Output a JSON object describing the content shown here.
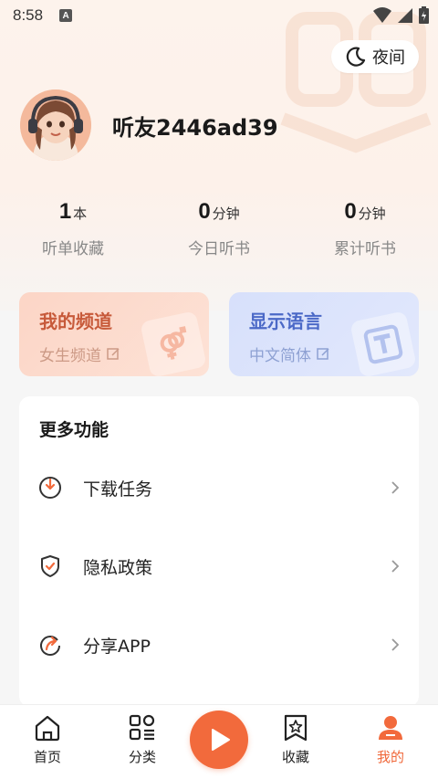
{
  "status_bar": {
    "time": "8:58",
    "notification_badge": "A"
  },
  "header": {
    "night_mode_label": "夜间"
  },
  "profile": {
    "username": "听友2446ad39"
  },
  "stats": [
    {
      "value": "1",
      "unit": "本",
      "label": "听单收藏"
    },
    {
      "value": "0",
      "unit": "分钟",
      "label": "今日听书"
    },
    {
      "value": "0",
      "unit": "分钟",
      "label": "累计听书"
    }
  ],
  "cards": {
    "channel": {
      "title": "我的频道",
      "value": "女生频道"
    },
    "language": {
      "title": "显示语言",
      "value": "中文简体"
    }
  },
  "more": {
    "title": "更多功能",
    "items": [
      {
        "label": "下载任务",
        "icon": "download-icon"
      },
      {
        "label": "隐私政策",
        "icon": "shield-check-icon"
      },
      {
        "label": "分享APP",
        "icon": "share-icon"
      }
    ]
  },
  "bottom_nav": {
    "items": [
      {
        "label": "首页",
        "icon": "home-icon"
      },
      {
        "label": "分类",
        "icon": "category-icon"
      },
      {
        "label": "收藏",
        "icon": "bookmark-star-icon"
      },
      {
        "label": "我的",
        "icon": "profile-icon",
        "active": true
      }
    ]
  },
  "colors": {
    "accent": "#f26a3c",
    "channel_title": "#c75a3a",
    "language_title": "#4b69c7"
  }
}
